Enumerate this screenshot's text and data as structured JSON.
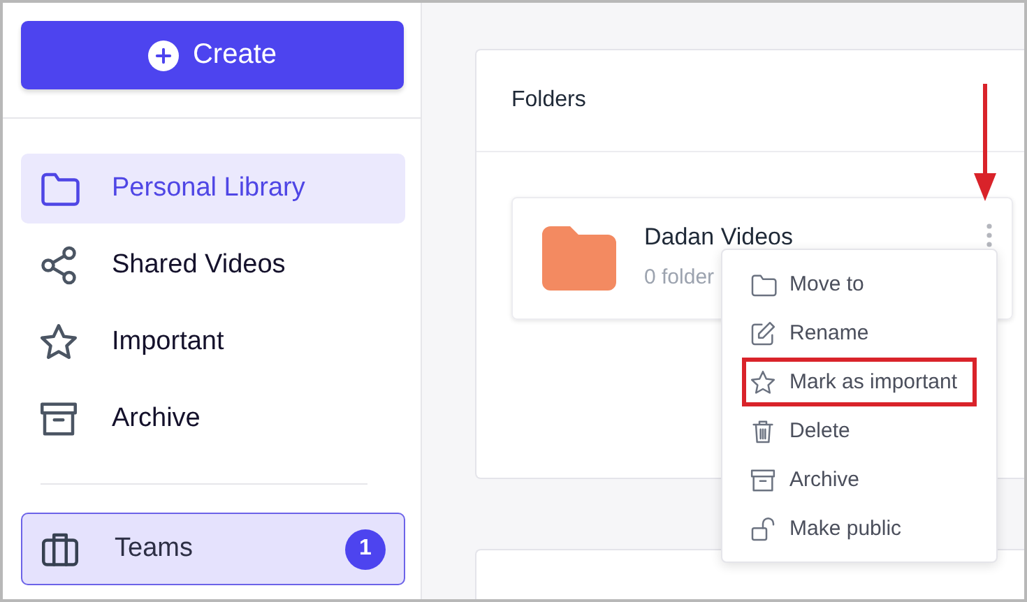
{
  "sidebar": {
    "create_button": {
      "label": "Create"
    },
    "nav_items": [
      {
        "label": "Personal Library",
        "selected": true
      },
      {
        "label": "Shared Videos",
        "selected": false
      },
      {
        "label": "Important",
        "selected": false
      },
      {
        "label": "Archive",
        "selected": false
      }
    ],
    "teams": {
      "label": "Teams",
      "badge": "1",
      "selected": true
    }
  },
  "folders_panel": {
    "title": "Folders",
    "folder": {
      "name": "Dadan Videos",
      "subtitle": "0 folder"
    }
  },
  "context_menu": {
    "items": [
      {
        "label": "Move to",
        "highlighted": false
      },
      {
        "label": "Rename",
        "highlighted": false
      },
      {
        "label": "Mark as important",
        "highlighted": true
      },
      {
        "label": "Delete",
        "highlighted": false
      },
      {
        "label": "Archive",
        "highlighted": false
      },
      {
        "label": "Make public",
        "highlighted": false
      }
    ]
  }
}
